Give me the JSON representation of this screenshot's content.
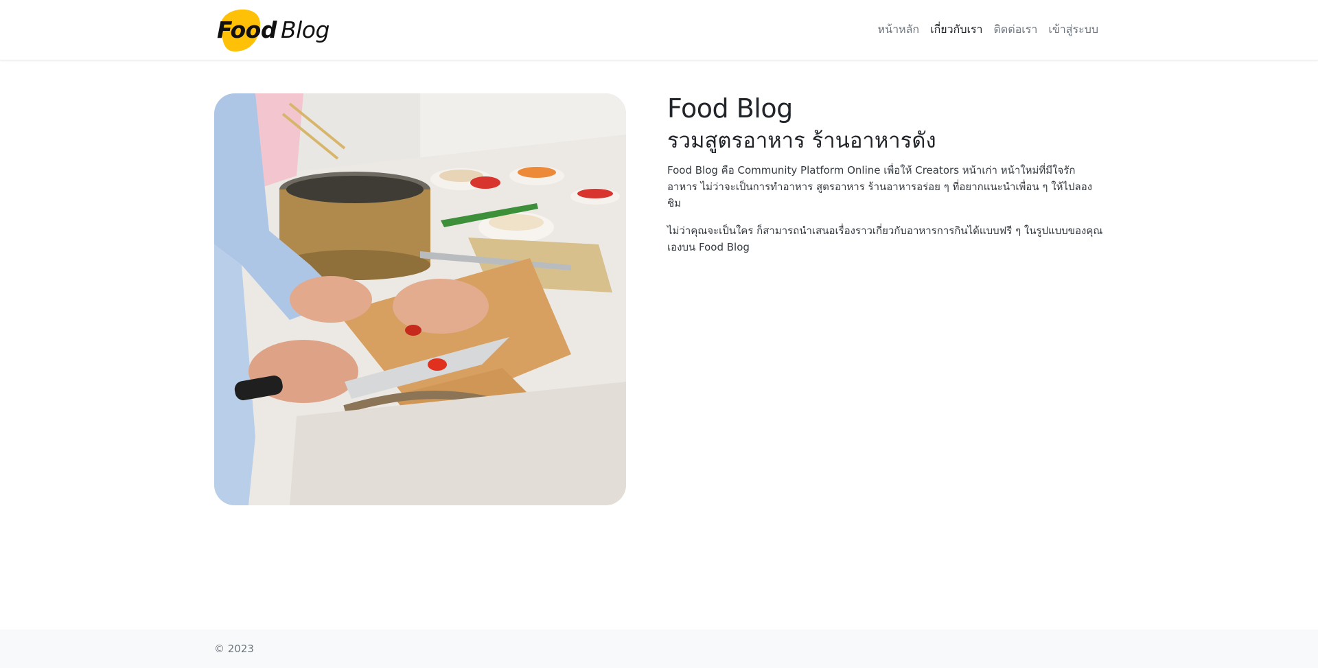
{
  "header": {
    "logo": {
      "part1": "Food",
      "part2": "Blog",
      "blob_color": "#FFC107"
    },
    "nav": [
      {
        "label": "หน้าหลัก",
        "active": false
      },
      {
        "label": "เกี่ยวกับเรา",
        "active": true
      },
      {
        "label": "ติดต่อเรา",
        "active": false
      },
      {
        "label": "เข้าสู่ระบบ",
        "active": false
      }
    ]
  },
  "main": {
    "image_subject": "hands-slicing-tomato-on-cutting-board",
    "title": "Food Blog",
    "subtitle": "รวมสูตรอาหาร ร้านอาหารดัง",
    "paragraphs": [
      "Food Blog คือ Community Platform Online เพื่อให้ Creators หน้าเก่า หน้าใหม่ที่มีใจรักอาหาร ไม่ว่าจะเป็นการทำอาหาร สูตรอาหาร ร้านอาหารอร่อย ๆ ที่อยากแนะนำเพื่อน ๆ ให้ไปลองชิม",
      "ไม่ว่าคุณจะเป็นใคร ก็สามารถนำเสนอเรื่องราวเกี่ยวกับอาหารการกินได้แบบฟรี ๆ ในรูปแบบของคุณเองบน Food Blog"
    ]
  },
  "footer": {
    "copyright": "© 2023"
  }
}
